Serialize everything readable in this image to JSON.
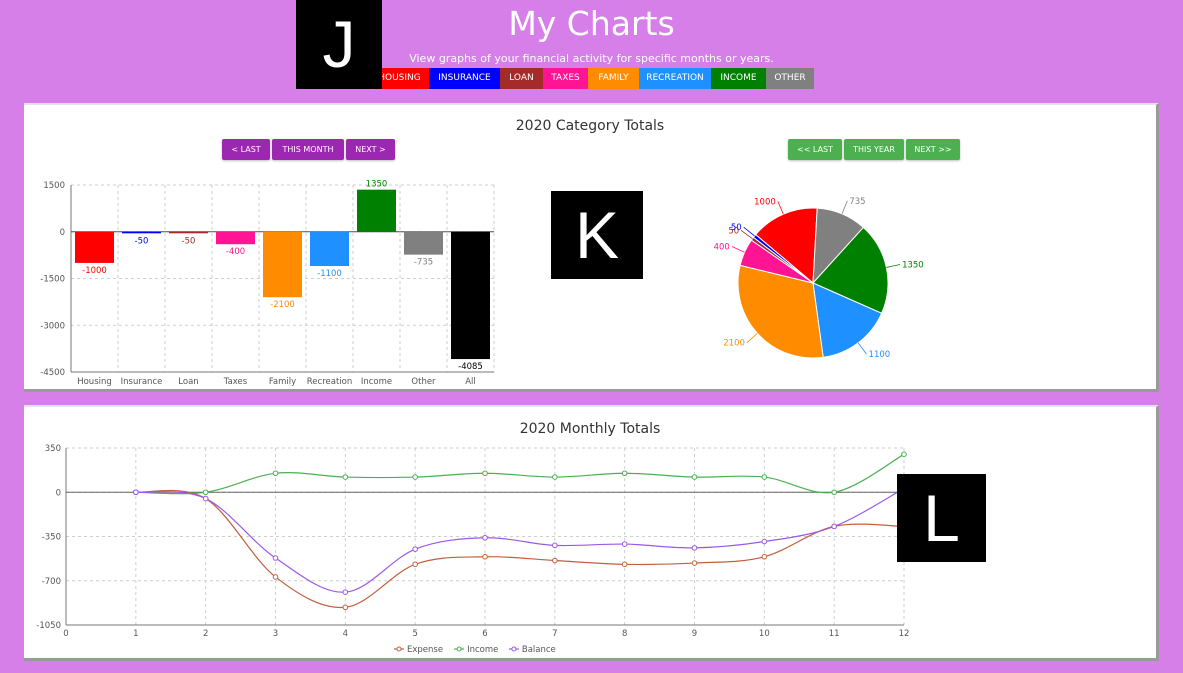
{
  "header": {
    "title": "My Charts",
    "subtitle": "View graphs of your financial activity for specific months or years."
  },
  "categories": [
    {
      "label": "HOUSING",
      "color": "#ff0000"
    },
    {
      "label": "INSURANCE",
      "color": "#0000ff"
    },
    {
      "label": "LOAN",
      "color": "#a52a2a"
    },
    {
      "label": "TAXES",
      "color": "#ff1493"
    },
    {
      "label": "FAMILY",
      "color": "#ff8c00"
    },
    {
      "label": "RECREATION",
      "color": "#1e90ff"
    },
    {
      "label": "INCOME",
      "color": "#008000"
    },
    {
      "label": "OTHER",
      "color": "#808080"
    }
  ],
  "markers": {
    "j": "J",
    "k": "K",
    "l": "L"
  },
  "category_panel": {
    "title": "2020 Category Totals",
    "month_nav": {
      "last": "< LAST",
      "current": "THIS MONTH",
      "next": "NEXT >"
    },
    "year_nav": {
      "last": "<< LAST",
      "current": "THIS YEAR",
      "next": "NEXT >>"
    }
  },
  "monthly_panel": {
    "title": "2020 Monthly Totals"
  },
  "chart_data": [
    {
      "type": "bar",
      "categories": [
        "Housing",
        "Insurance",
        "Loan",
        "Taxes",
        "Family",
        "Recreation",
        "Income",
        "Other",
        "All"
      ],
      "values": [
        -1000,
        -50,
        -50,
        -400,
        -2100,
        -1100,
        1350,
        -735,
        -4085
      ],
      "colors": [
        "#ff0000",
        "#0000ff",
        "#a52a2a",
        "#ff1493",
        "#ff8c00",
        "#1e90ff",
        "#008000",
        "#808080",
        "#000000"
      ],
      "ylim": [
        -4500,
        1500
      ],
      "yticks": [
        1500,
        0,
        -1500,
        -3000,
        -4500
      ],
      "grid": true
    },
    {
      "type": "pie",
      "slices": [
        {
          "label": "1000",
          "value": 1000,
          "color": "#ff0000"
        },
        {
          "label": "735",
          "value": 735,
          "color": "#808080"
        },
        {
          "label": "1350",
          "value": 1350,
          "color": "#008000"
        },
        {
          "label": "1100",
          "value": 1100,
          "color": "#1e90ff"
        },
        {
          "label": "2100",
          "value": 2100,
          "color": "#ff8c00"
        },
        {
          "label": "400",
          "value": 400,
          "color": "#ff1493"
        },
        {
          "label": "50",
          "value": 50,
          "color": "#a52a2a"
        },
        {
          "label": "50",
          "value": 50,
          "color": "#0000ff"
        }
      ]
    },
    {
      "type": "line",
      "x": [
        1,
        2,
        3,
        4,
        5,
        6,
        7,
        8,
        9,
        10,
        11,
        12
      ],
      "xlim": [
        0,
        12
      ],
      "ylim": [
        -1050,
        350
      ],
      "yticks": [
        350,
        0,
        -350,
        -700,
        -1050
      ],
      "xticks": [
        0,
        1,
        2,
        3,
        4,
        5,
        6,
        7,
        8,
        9,
        10,
        11,
        12
      ],
      "grid": true,
      "legend": "bottom-center",
      "series": [
        {
          "name": "Expense",
          "color": "#c0603c",
          "values": [
            0,
            -50,
            -670,
            -910,
            -570,
            -510,
            -540,
            -570,
            -560,
            -510,
            -270,
            -270
          ]
        },
        {
          "name": "Income",
          "color": "#4caf50",
          "values": [
            0,
            0,
            150,
            120,
            120,
            150,
            120,
            150,
            120,
            120,
            0,
            300
          ]
        },
        {
          "name": "Balance",
          "color": "#9b59e6",
          "values": [
            0,
            -50,
            -520,
            -790,
            -450,
            -360,
            -420,
            -410,
            -440,
            -390,
            -270,
            30
          ]
        }
      ]
    }
  ]
}
